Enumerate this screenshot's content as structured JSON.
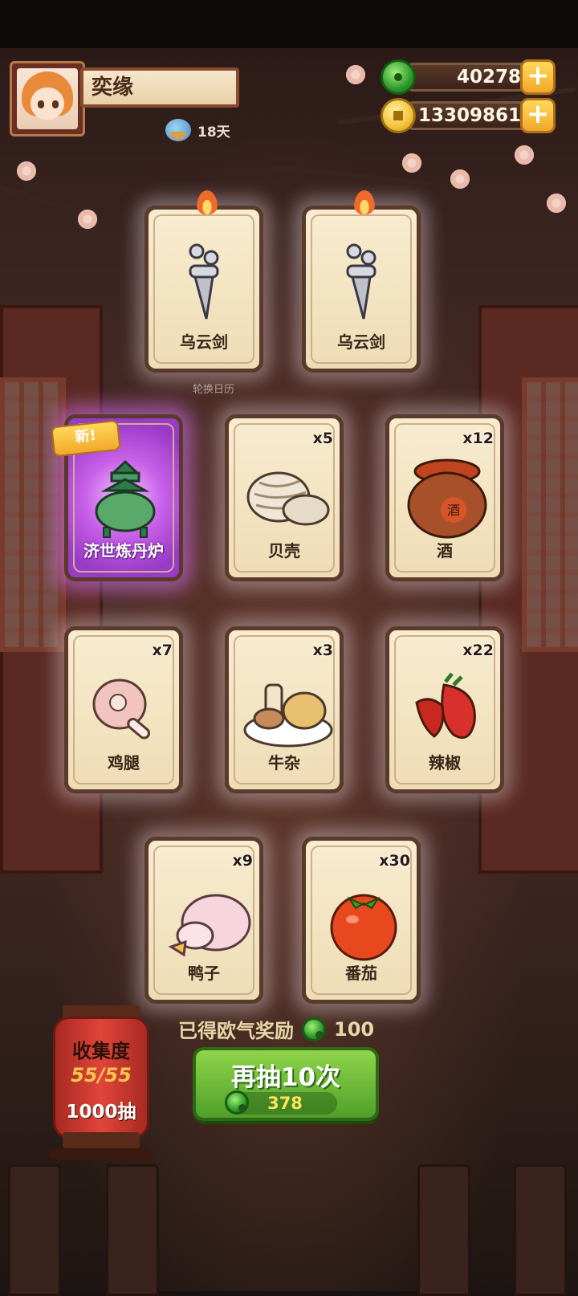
{
  "player": {
    "name": "奕缘",
    "days": "18天"
  },
  "currency": {
    "jade": "40278",
    "coins": "13309861",
    "plus": "+"
  },
  "cards": [
    {
      "label": "乌云剑",
      "count": "",
      "item": "sword"
    },
    {
      "label": "乌云剑",
      "count": "",
      "item": "sword"
    },
    {
      "label": "济世炼丹炉",
      "count": "",
      "item": "furnace",
      "badge": "新!"
    },
    {
      "label": "贝壳",
      "count": "x5",
      "item": "shell"
    },
    {
      "label": "酒",
      "count": "x12",
      "item": "wine-jar"
    },
    {
      "label": "鸡腿",
      "count": "x7",
      "item": "drumstick"
    },
    {
      "label": "牛杂",
      "count": "x3",
      "item": "beef-offal"
    },
    {
      "label": "辣椒",
      "count": "x22",
      "item": "chili"
    },
    {
      "label": "鸭子",
      "count": "x9",
      "item": "duck"
    },
    {
      "label": "番茄",
      "count": "x30",
      "item": "tomato"
    }
  ],
  "background_text": "轮换日历",
  "reward": {
    "text": "已得欧气奖励",
    "amount": "100"
  },
  "collection": {
    "title": "收集度",
    "progress": "55/55",
    "draws": "1000抽"
  },
  "draw_again": {
    "label": "再抽10次",
    "cost": "378"
  },
  "colors": {
    "jade": "#2f9a2a",
    "coin": "#f3c23a",
    "button": "#5fb030",
    "special_card": "#c860e8"
  }
}
